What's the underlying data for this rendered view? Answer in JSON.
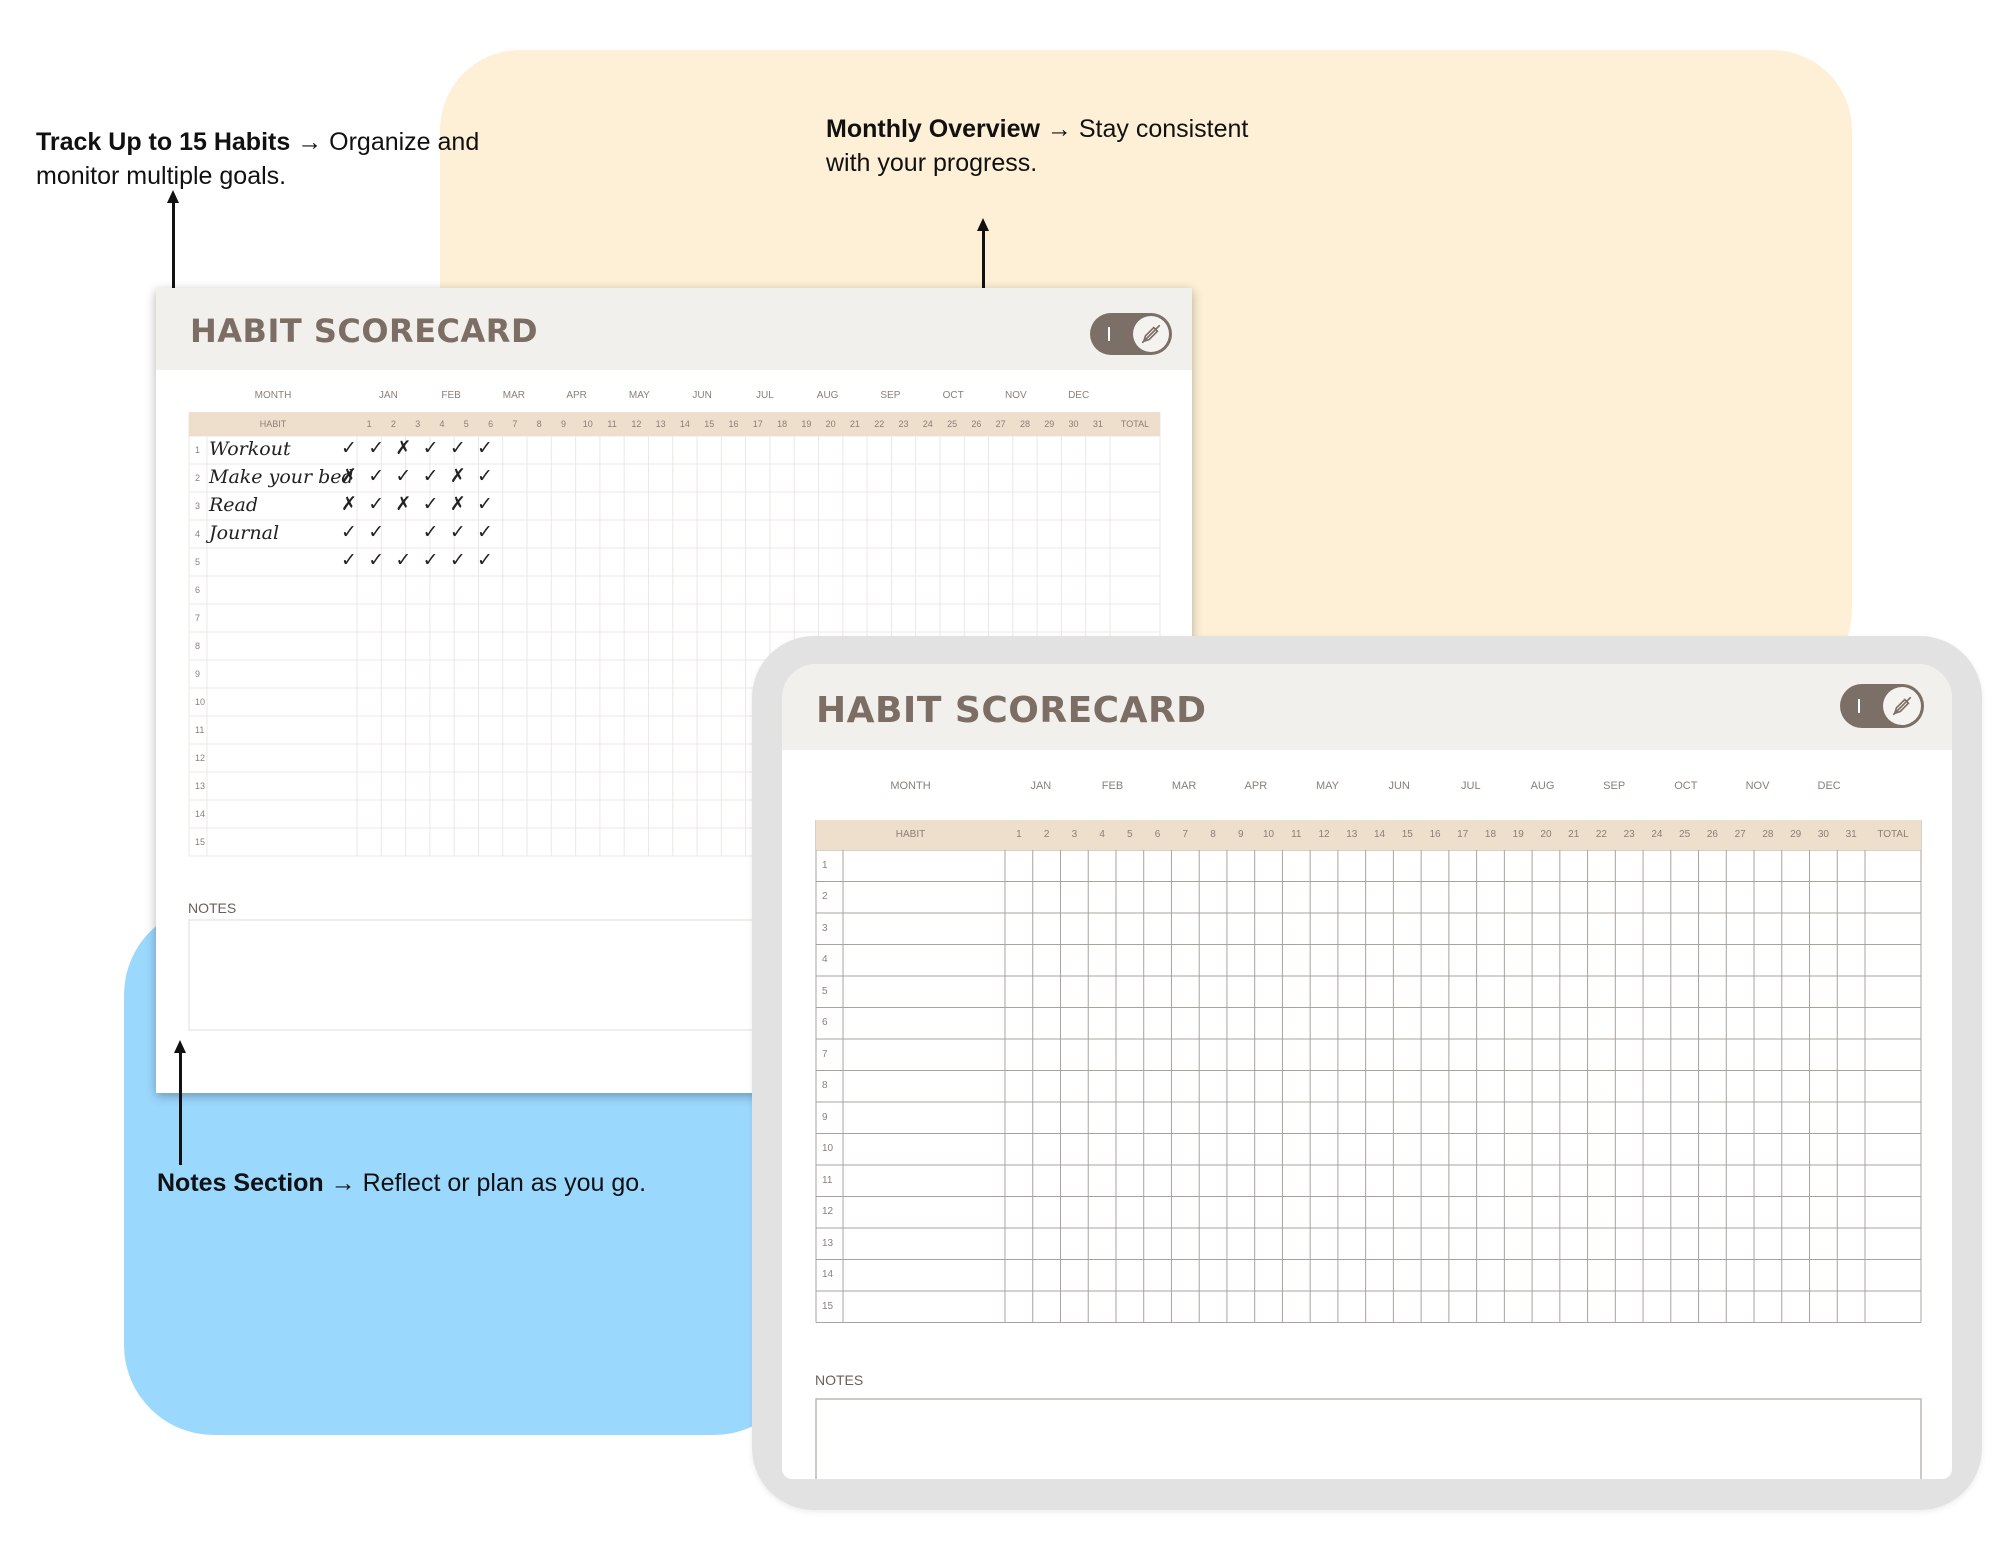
{
  "callouts": {
    "habits": {
      "bold": "Track Up to 15 Habits",
      "rest": " → Organize and monitor multiple goals."
    },
    "overview": {
      "bold": "Monthly Overview",
      "rest": " → Stay consistent with your progress."
    },
    "notes": {
      "bold": "Notes Section",
      "rest": " → Reflect or plan as you go."
    }
  },
  "scorecard": {
    "title": "HABIT SCORECARD",
    "month_label": "MONTH",
    "habit_label": "HABIT",
    "total_label": "TOTAL",
    "notes_label": "NOTES",
    "months": [
      "JAN",
      "FEB",
      "MAR",
      "APR",
      "MAY",
      "JUN",
      "JUL",
      "AUG",
      "SEP",
      "OCT",
      "NOV",
      "DEC"
    ],
    "days": [
      "1",
      "2",
      "3",
      "4",
      "5",
      "6",
      "7",
      "8",
      "9",
      "10",
      "11",
      "12",
      "13",
      "14",
      "15",
      "16",
      "17",
      "18",
      "19",
      "20",
      "21",
      "22",
      "23",
      "24",
      "25",
      "26",
      "27",
      "28",
      "29",
      "30",
      "31"
    ],
    "rows": [
      "1",
      "2",
      "3",
      "4",
      "5",
      "6",
      "7",
      "8",
      "9",
      "10",
      "11",
      "12",
      "13",
      "14",
      "15"
    ]
  },
  "filled_habits": [
    {
      "name": "Workout",
      "marks": [
        "✓",
        "✓",
        "✗",
        "✓",
        "✓",
        "✓"
      ]
    },
    {
      "name": "Make your bed",
      "marks": [
        "✗",
        "✓",
        "✓",
        "✓",
        "✗",
        "✓"
      ]
    },
    {
      "name": "Read",
      "marks": [
        "✗",
        "✓",
        "✗",
        "✓",
        "✗",
        "✓"
      ]
    },
    {
      "name": "Journal",
      "marks": [
        "✓",
        "✓",
        "",
        "✓",
        "✓",
        "✓"
      ]
    },
    {
      "name": "",
      "marks": [
        "✓",
        "✓",
        "✓",
        "✓",
        "✓",
        "✓"
      ]
    }
  ],
  "icons": {
    "toggle": "pencil-off-icon"
  },
  "colors": {
    "title": "#7c6e64",
    "band": "#eddfcc",
    "header_bg": "#f2f0ec",
    "yellow": "#fdf0d6",
    "blue": "#9bd8fe",
    "toggle": "#7b6f67"
  }
}
